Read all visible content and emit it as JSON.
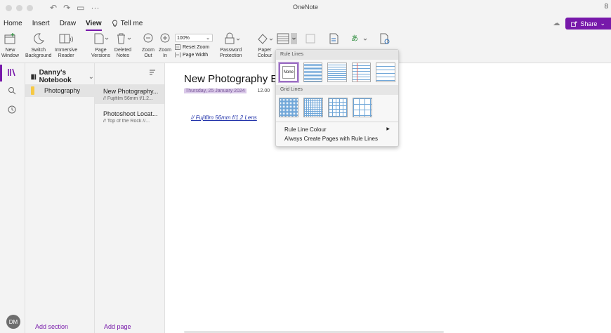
{
  "window": {
    "title": "OneNote",
    "account_glyph": "8"
  },
  "quick_access": {
    "undo": "↶",
    "redo": "↷",
    "open": "▭",
    "more": "···"
  },
  "tabs": [
    {
      "label": "Home"
    },
    {
      "label": "Insert"
    },
    {
      "label": "Draw"
    },
    {
      "label": "View"
    }
  ],
  "tell_me": {
    "label": "Tell me"
  },
  "share": {
    "label": "Share",
    "chev": "⌄"
  },
  "ribbon": {
    "new_window": "New\nWindow",
    "switch_background": "Switch\nBackground",
    "immersive_reader": "Immersive\nReader",
    "page_versions": "Page\nVersions",
    "deleted_notes": "Deleted\nNotes",
    "zoom_out": "Zoom\nOut",
    "zoom_in": "Zoom\nIn",
    "zoom_value": "100%",
    "reset_zoom": "Reset Zoom",
    "page_width": "Page Width",
    "password_protection": "Password\nProtection",
    "paper_colour": "Paper\nColour"
  },
  "notebook": {
    "name": "Danny's Notebook"
  },
  "sections": [
    {
      "label": "Photography",
      "color": "#f6c945"
    }
  ],
  "add_section": "Add section",
  "pages": [
    {
      "title": "New Photography...",
      "preview": "// Fujifilm 56mm f/1.2..."
    },
    {
      "title": "Photoshoot Locat...",
      "preview": "// Top of the Rock  //..."
    }
  ],
  "add_page": "Add page",
  "page": {
    "title": "New Photography Ed",
    "date": "Thursday, 25 January 2024",
    "time": "12.00",
    "link": "// Fujifilm 56mm f/1.2 Lens"
  },
  "rule_menu": {
    "rule_lines_header": "Rule Lines",
    "none_label": "None",
    "grid_lines_header": "Grid Lines",
    "rule_line_colour": "Rule Line Colour",
    "always_create": "Always Create Pages with Rule Lines",
    "submenu_arrow": "▶"
  },
  "user": {
    "initials": "DM"
  },
  "colors": {
    "accent": "#7719aa",
    "section_yellow": "#f6c945",
    "link": "#2233aa",
    "date_highlight": "#d9c8e8"
  }
}
